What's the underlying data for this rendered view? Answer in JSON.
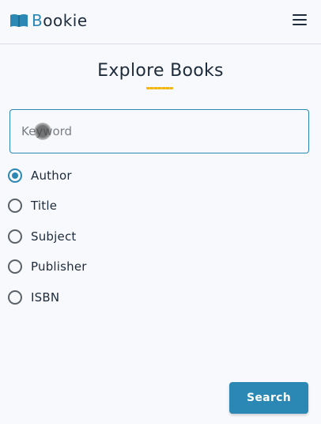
{
  "app": {
    "logo_first_letter": "B",
    "logo_rest": "ookie",
    "brand_color": "#2b87b3",
    "accent_color": "#f2b511"
  },
  "header": {
    "menu_icon": "hamburger-menu-icon"
  },
  "main": {
    "title": "Explore Books",
    "keyword": {
      "value": "",
      "placeholder": "Keyword"
    },
    "search_by": {
      "selected": "Author",
      "options": [
        "Author",
        "Title",
        "Subject",
        "Publisher",
        "ISBN"
      ]
    },
    "search_label": "Search"
  }
}
